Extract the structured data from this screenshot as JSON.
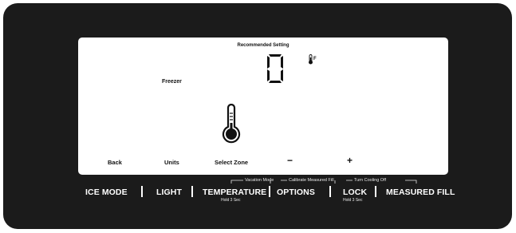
{
  "display": {
    "recommended_label": "Recommended Setting",
    "set_temperature": "0",
    "temperature_unit": "F",
    "zone": "Freezer"
  },
  "controls": {
    "back": "Back",
    "units": "Units",
    "select_zone": "Select Zone",
    "minus": "−",
    "plus": "+"
  },
  "hold_functions": {
    "vacation_mode": "Vacation Mode",
    "calibrate_measured_fill": "Calibrate Measured Fill",
    "turn_cooling_off": "Turn Cooling Off"
  },
  "buttons": {
    "ice_mode": "ICE MODE",
    "light": "LIGHT",
    "temperature": "TEMPERATURE",
    "temperature_sub": "Hold 3 Sec",
    "options": "OPTIONS",
    "lock": "LOCK",
    "lock_sub": "Hold 3 Sec",
    "measured_fill": "MEASURED FILL"
  },
  "colors": {
    "panel": "#1b1b1b",
    "display": "#ffffff",
    "text_on_panel": "#ffffff"
  },
  "icons": [
    "seven-segment-digit",
    "thermometer-unit-icon",
    "thermometer-icon"
  ]
}
